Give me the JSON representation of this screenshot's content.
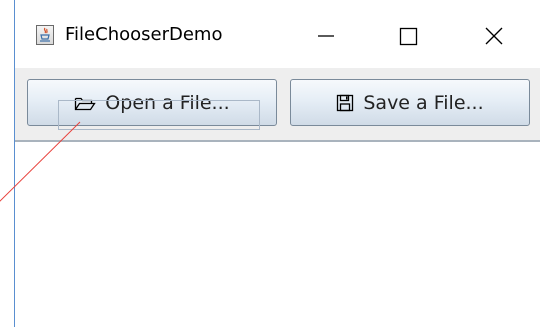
{
  "window": {
    "title": "FileChooserDemo"
  },
  "title_bar": {
    "minimize_icon": "minimize-icon",
    "maximize_icon": "maximize-icon",
    "close_icon": "close-icon"
  },
  "toolbar": {
    "open_label": "Open a File...",
    "save_label": "Save a File...",
    "open_icon": "folder-open-icon",
    "save_icon": "floppy-disk-icon"
  },
  "log": {
    "text": ""
  },
  "colors": {
    "window_border": "#5a8fd0",
    "toolbar_bg": "#eeeeee",
    "annotation_line": "#e8403a"
  }
}
